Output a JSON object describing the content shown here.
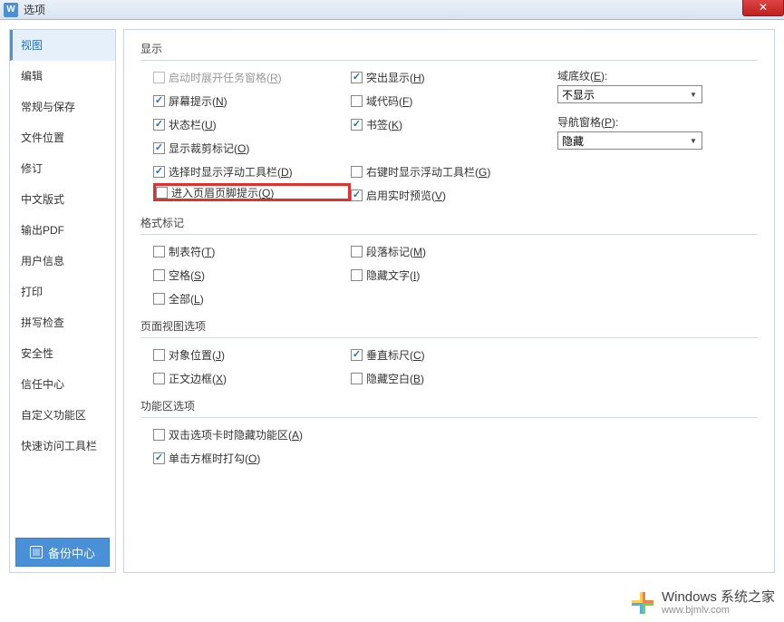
{
  "titlebar": {
    "icon_char": "W",
    "title": "选项"
  },
  "sidebar": {
    "items": [
      "视图",
      "编辑",
      "常规与保存",
      "文件位置",
      "修订",
      "中文版式",
      "输出PDF",
      "用户信息",
      "打印",
      "拼写检查",
      "安全性",
      "信任中心",
      "自定义功能区",
      "快速访问工具栏"
    ],
    "backup_label": "备份中心"
  },
  "sections": {
    "display": {
      "title": "显示",
      "col1": [
        {
          "label": "启动时展开任务窗格(",
          "key": "R",
          "checked": false,
          "disabled": true
        },
        {
          "label": "屏幕提示(",
          "key": "N",
          "checked": true
        },
        {
          "label": "状态栏(",
          "key": "U",
          "checked": true
        },
        {
          "label": "显示裁剪标记(",
          "key": "O",
          "checked": true
        },
        {
          "label": "选择时显示浮动工具栏(",
          "key": "D",
          "checked": true
        },
        {
          "label": "进入页眉页脚提示(",
          "key": "Q",
          "checked": false,
          "highlighted": true
        }
      ],
      "col2": [
        {
          "label": "突出显示(",
          "key": "H",
          "checked": true
        },
        {
          "label": "域代码(",
          "key": "F",
          "checked": false
        },
        {
          "label": "书签(",
          "key": "K",
          "checked": true
        },
        {
          "spacer": true
        },
        {
          "label": "右键时显示浮动工具栏(",
          "key": "G",
          "checked": false
        },
        {
          "label": "启用实时预览(",
          "key": "V",
          "checked": true
        }
      ],
      "col3": {
        "shading": {
          "label": "域底纹(",
          "key": "E",
          "value": "不显示"
        },
        "navpane": {
          "label": "导航窗格(",
          "key": "P",
          "value": "隐藏"
        }
      }
    },
    "format_marks": {
      "title": "格式标记",
      "col1": [
        {
          "label": "制表符(",
          "key": "T",
          "checked": false
        },
        {
          "label": "空格(",
          "key": "S",
          "checked": false
        },
        {
          "label": "全部(",
          "key": "L",
          "checked": false
        }
      ],
      "col2": [
        {
          "label": "段落标记(",
          "key": "M",
          "checked": false
        },
        {
          "label": "隐藏文字(",
          "key": "I",
          "checked": false
        }
      ]
    },
    "page_view": {
      "title": "页面视图选项",
      "col1": [
        {
          "label": "对象位置(",
          "key": "J",
          "checked": false
        },
        {
          "label": "正文边框(",
          "key": "X",
          "checked": false
        }
      ],
      "col2": [
        {
          "label": "垂直标尺(",
          "key": "C",
          "checked": true
        },
        {
          "label": "隐藏空白(",
          "key": "B",
          "checked": false
        }
      ]
    },
    "ribbon": {
      "title": "功能区选项",
      "items": [
        {
          "label": "双击选项卡时隐藏功能区(",
          "key": "A",
          "checked": false
        },
        {
          "label": "单击方框时打勾(",
          "key": "O",
          "checked": true
        }
      ]
    }
  },
  "watermark": {
    "top": "Windows 系统之家",
    "bottom": "www.bjmlv.com"
  }
}
